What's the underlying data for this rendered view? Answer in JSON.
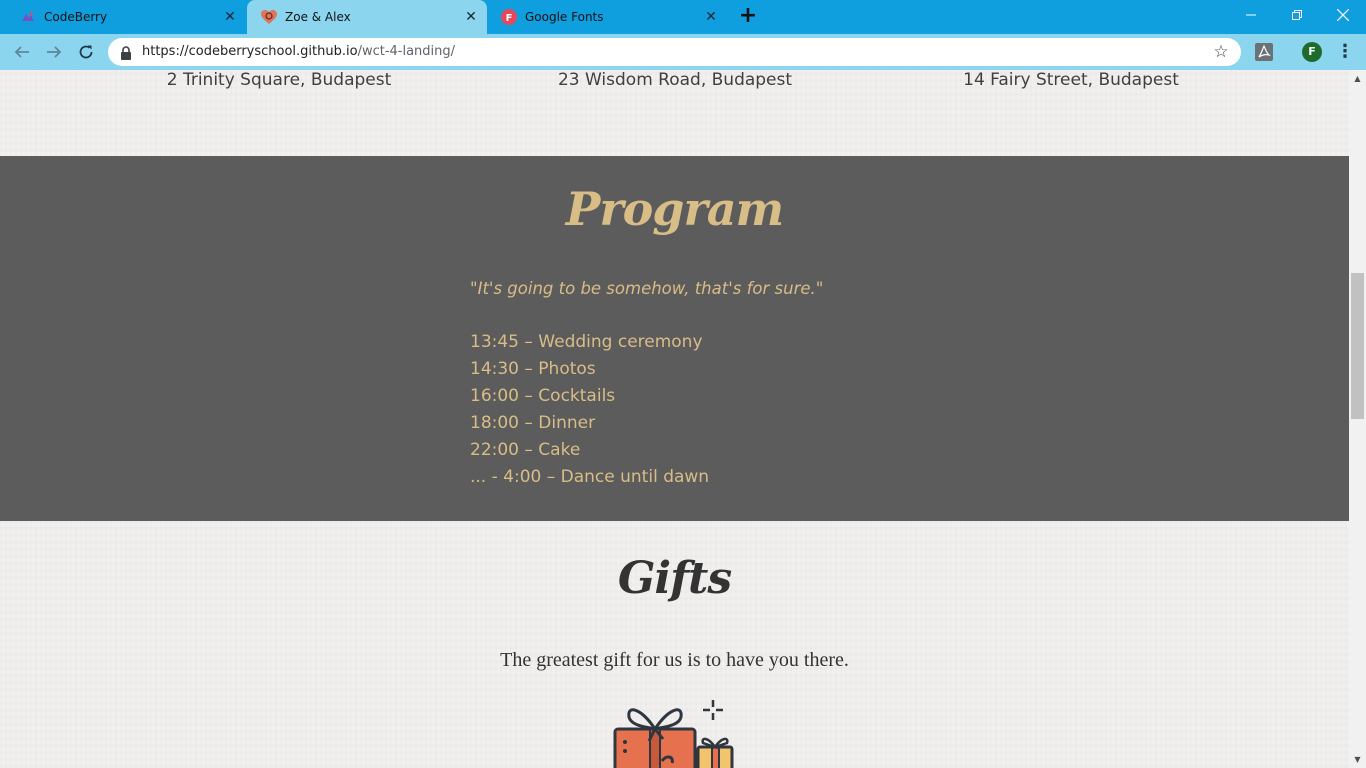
{
  "browser": {
    "tabs": [
      {
        "title": "CodeBerry",
        "favicon": "codeberry-icon",
        "active": false
      },
      {
        "title": "Zoe & Alex",
        "favicon": "heart-icon",
        "active": true
      },
      {
        "title": "Google Fonts",
        "favicon": "google-fonts-icon",
        "favicon_letter": "F",
        "active": false
      }
    ],
    "new_tab_label": "+",
    "url_host": "https://codeberryschool.github.io",
    "url_path": "/wct-4-landing/",
    "profile_initial": "F",
    "colors": {
      "tab_strip": "#0f9ede",
      "active_tab": "#8bd6ee",
      "toolbar": "#8bd6ee"
    }
  },
  "page": {
    "venues": [
      {
        "address": "2 Trinity Square, Budapest"
      },
      {
        "address": "23 Wisdom Road, Budapest"
      },
      {
        "address": "14 Fairy Street, Budapest"
      }
    ],
    "program": {
      "title": "Program",
      "quote": "\"It's going to be somehow, that's for sure.\"",
      "schedule": [
        "13:45 – Wedding ceremony",
        "14:30 – Photos",
        "16:00 – Cocktails",
        "18:00 – Dinner",
        "22:00 – Cake",
        "... - 4:00 – Dance until dawn"
      ],
      "colors": {
        "background": "#5c5c5c",
        "accent": "#d8bd87"
      }
    },
    "gifts": {
      "title": "Gifts",
      "text": "The greatest gift for us is to have you there.",
      "illustration": "gift-boxes-icon"
    }
  },
  "scrollbar": {
    "position_fraction": 0.36,
    "visible_fraction": 0.22
  }
}
